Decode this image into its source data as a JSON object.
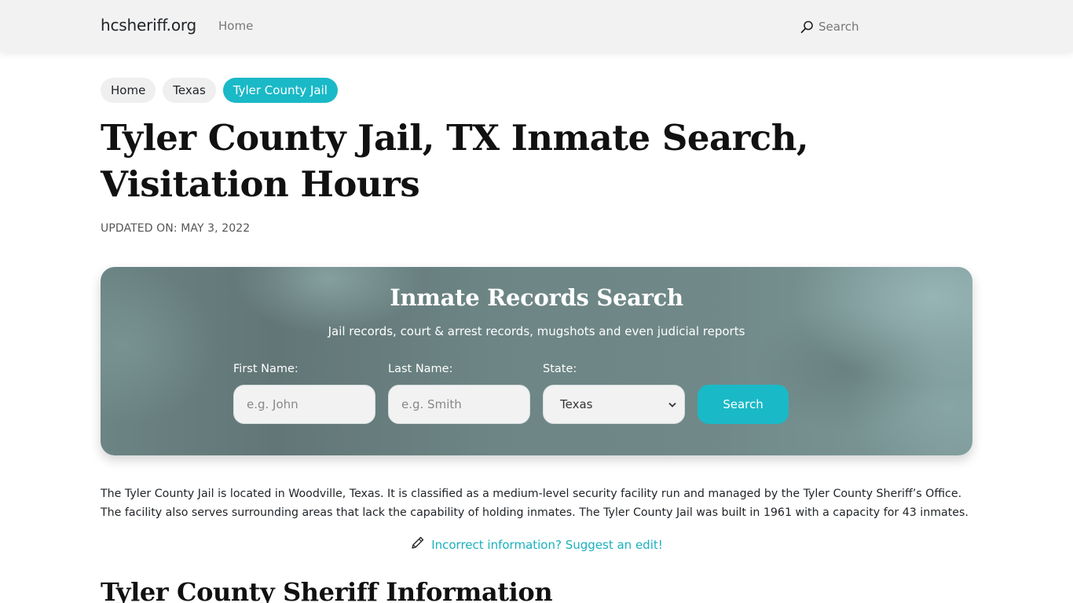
{
  "navbar": {
    "brand": "hcsheriff.org",
    "links": [
      {
        "label": "Home"
      }
    ],
    "search": {
      "icon": "search-icon",
      "label": "Search"
    }
  },
  "breadcrumb": [
    {
      "label": "Home",
      "active": false
    },
    {
      "label": "Texas",
      "active": false
    },
    {
      "label": "Tyler County Jail",
      "active": true
    }
  ],
  "page": {
    "title": "Tyler County Jail, TX Inmate Search, Visitation Hours",
    "updated": "UPDATED ON: MAY 3, 2022"
  },
  "search_card": {
    "title": "Inmate Records Search",
    "subtitle": "Jail records, court & arrest records, mugshots and even judicial reports",
    "first_name": {
      "label": "First Name:",
      "placeholder": "e.g. John",
      "value": ""
    },
    "last_name": {
      "label": "Last Name:",
      "placeholder": "e.g. Smith",
      "value": ""
    },
    "state": {
      "label": "State:",
      "selected": "Texas"
    },
    "button": "Search"
  },
  "content": {
    "intro": "The Tyler County Jail is located in Woodville, Texas. It is classified as a medium-level security facility run and managed by the Tyler County Sheriff’s Office. The facility also serves surrounding areas that lack the capability of holding inmates. The Tyler County Jail was built in 1961 with a capacity for 43 inmates.",
    "suggest_edit": {
      "icon": "pencil-icon",
      "label": "Incorrect information? Suggest an edit!"
    },
    "section_heading": "Tyler County Sheriff Information"
  },
  "colors": {
    "accent": "#1ab9c7",
    "navbar_bg": "#f2f2f2",
    "card_bg": "#6c8484"
  }
}
